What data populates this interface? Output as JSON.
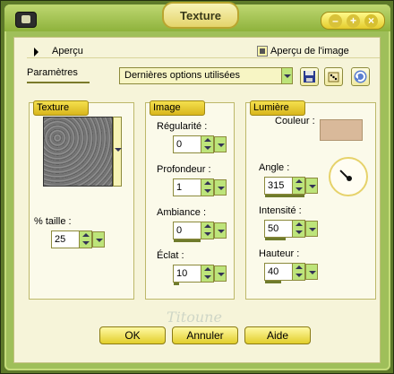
{
  "window": {
    "title": "Texture",
    "controls": [
      "–",
      "+",
      "×"
    ]
  },
  "top": {
    "apercu_label": "Aperçu",
    "preview_checkbox_label": "Aperçu de l'image",
    "preview_checked": true
  },
  "params": {
    "tab_label": "Paramètres",
    "preset_value": "Dernières options utilisées"
  },
  "toolbar": {
    "save_icon": "save-icon",
    "dice_icon": "dice-icon",
    "reset_icon": "refresh-icon"
  },
  "texture": {
    "panel_title": "Texture",
    "taille_label": "% taille :",
    "taille_value": "25"
  },
  "image": {
    "panel_title": "Image",
    "regularite_label": "Régularité :",
    "regularite_value": "0",
    "profondeur_label": "Profondeur :",
    "profondeur_value": "1",
    "ambiance_label": "Ambiance :",
    "ambiance_value": "0",
    "eclat_label": "Éclat :",
    "eclat_value": "10"
  },
  "lumiere": {
    "panel_title": "Lumière",
    "couleur_label": "Couleur :",
    "couleur_hex": "#d9b99a",
    "angle_label": "Angle :",
    "angle_value": "315",
    "intensite_label": "Intensité :",
    "intensite_value": "50",
    "hauteur_label": "Hauteur :",
    "hauteur_value": "40"
  },
  "watermark": "Titoune",
  "buttons": {
    "ok": "OK",
    "cancel": "Annuler",
    "help": "Aide"
  }
}
